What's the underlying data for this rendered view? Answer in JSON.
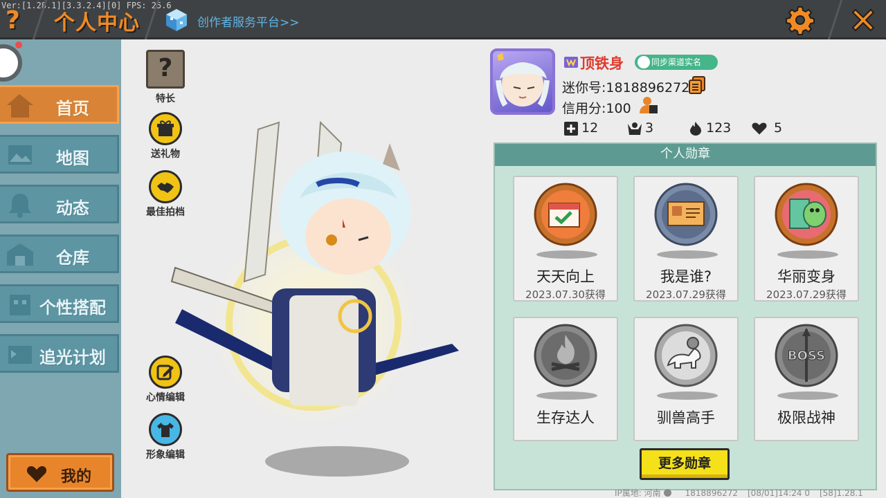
{
  "debug_text": "Ver:[1.28.1][3.3.2.4][0] FPS: 25.6",
  "header": {
    "title": "个人中心",
    "platform_link": "创作者服务平台>>"
  },
  "sidebar": {
    "items": [
      {
        "label": "首页",
        "icon": "house-icon",
        "active": true
      },
      {
        "label": "地图",
        "icon": "map-icon",
        "active": false
      },
      {
        "label": "动态",
        "icon": "bell-icon",
        "active": false
      },
      {
        "label": "仓库",
        "icon": "warehouse-icon",
        "active": false
      },
      {
        "label": "个性搭配",
        "icon": "outfit-icon",
        "active": false
      },
      {
        "label": "追光计划",
        "icon": "spotlight-icon",
        "active": false
      }
    ],
    "mine_button": "我的"
  },
  "actions": {
    "talent": "特长",
    "gift": "送礼物",
    "best_shot": "最佳拍档",
    "mood_edit": "心情编辑",
    "image_edit": "形象编辑"
  },
  "profile": {
    "username": "顶铁身",
    "realname_badge": "同步渠道实名",
    "mini_id": "迷你号:1818896272",
    "credit": "信用分:100",
    "stats": {
      "friends": "12",
      "fans": "3",
      "popularity": "123",
      "likes": "5"
    }
  },
  "medals": {
    "header": "个人勋章",
    "items": [
      {
        "name": "天天向上",
        "date": "2023.07.30获得",
        "earned": true
      },
      {
        "name": "我是谁?",
        "date": "2023.07.29获得",
        "earned": true
      },
      {
        "name": "华丽变身",
        "date": "2023.07.29获得",
        "earned": true
      },
      {
        "name": "生存达人",
        "date": "",
        "earned": false
      },
      {
        "name": "驯兽高手",
        "date": "",
        "earned": false
      },
      {
        "name": "极限战神",
        "date": "",
        "earned": false
      }
    ],
    "more_button": "更多勋章"
  },
  "footer": {
    "ip": "IP属地: 河南",
    "uid": "1818896272",
    "time": "[08/01]14:24 0",
    "version": "[58]1.28.1"
  },
  "colors": {
    "accent_orange": "#f08a24",
    "sidebar_bg": "#7fa7b1",
    "nav_active": "#d98336",
    "medal_panel": "#c7e3d8",
    "username_red": "#e03a2e"
  }
}
